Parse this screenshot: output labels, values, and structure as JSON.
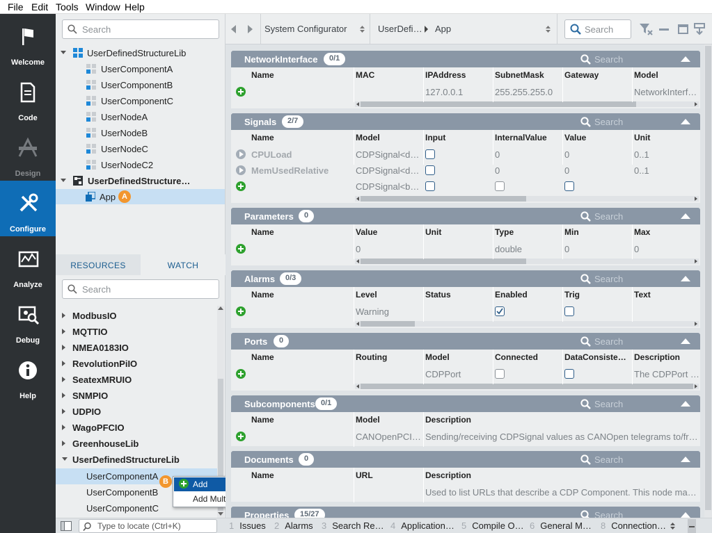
{
  "menu": {
    "file": "File",
    "edit": "Edit",
    "tools": "Tools",
    "window": "Window",
    "help": "Help"
  },
  "nav": {
    "welcome": "Welcome",
    "code": "Code",
    "design": "Design",
    "configure": "Configure",
    "analyze": "Analyze",
    "debug": "Debug",
    "help": "Help"
  },
  "tree": {
    "search_placeholder": "Search",
    "lib": "UserDefinedStructureLib",
    "lib_items": [
      "UserComponentA",
      "UserComponentB",
      "UserComponentC",
      "UserNodeA",
      "UserNodeB",
      "UserNodeC",
      "UserNodeC2"
    ],
    "system": "UserDefinedStructure…",
    "app": "App",
    "app_marker": "A"
  },
  "tabs": {
    "resources": "RESOURCES",
    "watch": "WATCH"
  },
  "resources": {
    "search_placeholder": "Search",
    "items": [
      "ModbusIO",
      "MQTTIO",
      "NMEA0183IO",
      "RevolutionPiIO",
      "SeatexMRUIO",
      "SNMPIO",
      "UDPIO",
      "WagoPFCIO",
      "GreenhouseLib",
      "UserDefinedStructureLib"
    ],
    "sub_items": [
      "UserComponentA",
      "UserComponentB",
      "UserComponentC"
    ],
    "marker": "B"
  },
  "context_menu": {
    "add": "Add",
    "add_multiple": "Add Multiple..."
  },
  "topbar": {
    "configurator": "System Configurator",
    "crumb1": "UserDefi…",
    "crumb2": "App",
    "search_placeholder": "Search"
  },
  "sections": {
    "network": {
      "title": "NetworkInterface",
      "badge": "0/1",
      "search": "Search",
      "cols": [
        "Name",
        "MAC",
        "IPAddress",
        "SubnetMask",
        "Gateway",
        "Model"
      ],
      "row": [
        "",
        "",
        "127.0.0.1",
        "255.255.255.0",
        "",
        "NetworkInterf…"
      ]
    },
    "signals": {
      "title": "Signals",
      "badge": "2/7",
      "search": "Search",
      "cols": [
        "Name",
        "Model",
        "Input",
        "InternalValue",
        "Value",
        "Unit"
      ],
      "rows": [
        [
          "CPULoad",
          "CDPSignal<d…",
          "",
          "0",
          "0",
          "0..1"
        ],
        [
          "MemUsedRelative",
          "CDPSignal<d…",
          "",
          "0",
          "0",
          "0..1"
        ],
        [
          "",
          "CDPSignal<b…",
          "",
          "",
          "",
          ""
        ]
      ]
    },
    "parameters": {
      "title": "Parameters",
      "badge": "0",
      "search": "Search",
      "cols": [
        "Name",
        "Value",
        "Unit",
        "Type",
        "Min",
        "Max"
      ],
      "row": [
        "",
        "0",
        "",
        "double",
        "0",
        "0"
      ]
    },
    "alarms": {
      "title": "Alarms",
      "badge": "0/3",
      "search": "Search",
      "cols": [
        "Name",
        "Level",
        "Status",
        "Enabled",
        "Trig",
        "Text"
      ],
      "row": [
        "",
        "Warning",
        "",
        "",
        "",
        ""
      ]
    },
    "ports": {
      "title": "Ports",
      "badge": "0",
      "search": "Search",
      "cols": [
        "Name",
        "Routing",
        "Model",
        "Connected",
        "DataConsiste…",
        "Description"
      ],
      "row": [
        "",
        "",
        "CDPPort",
        "",
        "",
        "The CDPPort …"
      ]
    },
    "subcomponents": {
      "title": "Subcomponents",
      "badge": "0/1",
      "search": "Search",
      "cols": [
        "Name",
        "Model",
        "Description"
      ],
      "row": [
        "",
        "CANOpenPCI…",
        "Sending/receiving CDPSignal values as CANOpen telegrams to/fr…"
      ]
    },
    "documents": {
      "title": "Documents",
      "badge": "0",
      "search": "Search",
      "cols": [
        "Name",
        "URL",
        "Description"
      ],
      "row": [
        "",
        "",
        "Used to list URLs that describe a CDP Component. This node ma…"
      ]
    },
    "properties": {
      "title": "Properties",
      "badge": "15/27",
      "search": "Search"
    }
  },
  "status": {
    "locate_placeholder": "Type to locate (Ctrl+K)",
    "tabs": [
      {
        "n": "1",
        "label": "Issues"
      },
      {
        "n": "2",
        "label": "Alarms"
      },
      {
        "n": "3",
        "label": "Search Re…"
      },
      {
        "n": "4",
        "label": "Application…"
      },
      {
        "n": "5",
        "label": "Compile O…"
      },
      {
        "n": "6",
        "label": "General M…"
      },
      {
        "n": "8",
        "label": "Connection…"
      }
    ]
  },
  "colors": {
    "nav_bg": "#2d3134",
    "nav_selected": "#0f6db6",
    "section_header": "#8a97a6",
    "add_green": "#2ea12e",
    "marker_orange": "#f2962e",
    "menu_highlight": "#0f5aa5"
  }
}
